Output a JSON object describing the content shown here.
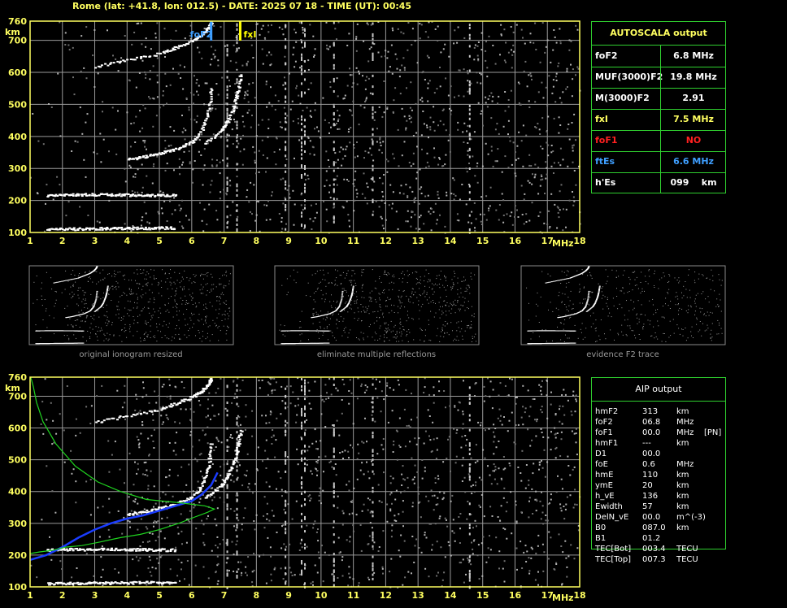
{
  "header": {
    "title": "Rome (lat: +41.8, lon: 012.5) - DATE: 2025 07 18 - TIME (UT): 00:45"
  },
  "colors": {
    "axis": "#ffff60",
    "grid": "#9a9a9a",
    "trace": "#ffffff",
    "box": "#2fcf2f",
    "foF2_marker": "#3f9fff",
    "fxI_marker": "#ffff00",
    "profile_blue": "#1a3cff",
    "profile_green": "#1fd41f",
    "nofoF1": "#ff2020"
  },
  "chart_data": [
    {
      "type": "scatter",
      "name": "main-ionogram",
      "title": "",
      "xlabel": "MHz",
      "ylabel": "km",
      "xlim": [
        1,
        18
      ],
      "ylim": [
        100,
        760
      ],
      "xticks": [
        1,
        2,
        3,
        4,
        5,
        6,
        7,
        8,
        9,
        10,
        11,
        12,
        13,
        14,
        15,
        16,
        17,
        18
      ],
      "yticks": [
        100,
        200,
        300,
        400,
        500,
        600,
        700,
        760
      ],
      "grid": true,
      "markers": [
        {
          "label": "foF2",
          "x": 6.6
        },
        {
          "label": "fxI",
          "x": 7.5
        }
      ],
      "traces": [
        {
          "name": "E-layer echo",
          "x": [
            1.5,
            2,
            2.5,
            3,
            3.5,
            4,
            4.5,
            5,
            5.5
          ],
          "y": [
            112,
            113,
            113,
            114,
            114,
            115,
            115,
            116,
            116
          ]
        },
        {
          "name": "second-hop E echo",
          "x": [
            1.5,
            2,
            2.5,
            3,
            3.5,
            4,
            4.5,
            5,
            5.5
          ],
          "y": [
            218,
            219,
            220,
            220,
            220,
            219,
            219,
            218,
            218
          ]
        },
        {
          "name": "F2 ordinary trace",
          "x": [
            4,
            4.5,
            5,
            5.5,
            6,
            6.3,
            6.5,
            6.6
          ],
          "y": [
            330,
            338,
            350,
            362,
            385,
            420,
            480,
            560
          ]
        },
        {
          "name": "F2 extraordinary trace",
          "x": [
            6.4,
            6.9,
            7.1,
            7.3,
            7.4,
            7.5
          ],
          "y": [
            380,
            420,
            450,
            500,
            540,
            600
          ]
        },
        {
          "name": "multiple F2 reflection",
          "x": [
            3,
            4,
            5,
            5.5,
            6,
            6.3,
            6.5,
            6.6
          ],
          "y": [
            620,
            640,
            660,
            680,
            700,
            720,
            740,
            760
          ]
        }
      ]
    },
    {
      "type": "line",
      "name": "aip-profile",
      "xlabel": "MHz",
      "ylabel": "km",
      "xlim": [
        1,
        18
      ],
      "ylim": [
        100,
        760
      ],
      "xticks": [
        1,
        2,
        3,
        4,
        5,
        6,
        7,
        8,
        9,
        10,
        11,
        12,
        13,
        14,
        15,
        16,
        17,
        18
      ],
      "yticks": [
        100,
        200,
        300,
        400,
        500,
        600,
        700,
        760
      ],
      "grid": true,
      "series": [
        {
          "color": "blue",
          "x": [
            1,
            1.5,
            2,
            2.5,
            3,
            3.5,
            4,
            4.5,
            5,
            5.5,
            6,
            6.3,
            6.6,
            6.8
          ],
          "y": [
            185,
            200,
            225,
            255,
            280,
            300,
            315,
            325,
            340,
            355,
            370,
            390,
            420,
            460
          ]
        },
        {
          "color": "green",
          "x": [
            1,
            1.3,
            1.7,
            2.1,
            2.6,
            3.1,
            3.8,
            4.4,
            5,
            5.6,
            6.1,
            6.5,
            6.7,
            6.4,
            5.6,
            4.6,
            3.8,
            3.1,
            2.4,
            1.8,
            1.4,
            1.2,
            1.1,
            1.02
          ],
          "y": [
            205,
            210,
            215,
            225,
            230,
            240,
            255,
            265,
            280,
            300,
            320,
            335,
            345,
            355,
            365,
            375,
            400,
            430,
            480,
            550,
            620,
            680,
            730,
            760
          ]
        }
      ]
    }
  ],
  "autoscala": {
    "title": "AUTOSCALA output",
    "rows": [
      {
        "label": "foF2",
        "value": "6.8 MHz",
        "color": "#ffffff"
      },
      {
        "label": "MUF(3000)F2",
        "value": "19.8 MHz",
        "color": "#ffffff"
      },
      {
        "label": "M(3000)F2",
        "value": "2.91",
        "color": "#ffffff"
      },
      {
        "label": "fxI",
        "value": "7.5 MHz",
        "color": "#ffff60"
      },
      {
        "label": "foF1",
        "value": "NO",
        "color": "#ff2020"
      },
      {
        "label": "ftEs",
        "value": "6.6 MHz",
        "color": "#3f9fff"
      },
      {
        "label": "h'Es",
        "value": "099    km",
        "color": "#ffffff"
      }
    ]
  },
  "aip": {
    "title": "AIP output",
    "rows": [
      {
        "name": "hmF2",
        "value": "313",
        "unit": "km",
        "extra": ""
      },
      {
        "name": "foF2",
        "value": "06.8",
        "unit": "MHz",
        "extra": ""
      },
      {
        "name": "foF1",
        "value": "00.0",
        "unit": "MHz",
        "extra": "[PN]"
      },
      {
        "name": "hmF1",
        "value": "---",
        "unit": "km",
        "extra": ""
      },
      {
        "name": "D1",
        "value": "00.0",
        "unit": "",
        "extra": ""
      },
      {
        "name": "foE",
        "value": "0.6",
        "unit": "MHz",
        "extra": ""
      },
      {
        "name": "hmE",
        "value": "110",
        "unit": "km",
        "extra": ""
      },
      {
        "name": "ymE",
        "value": "20",
        "unit": "km",
        "extra": ""
      },
      {
        "name": "h_vE",
        "value": "136",
        "unit": "km",
        "extra": ""
      },
      {
        "name": "Ewidth",
        "value": "57",
        "unit": "km",
        "extra": ""
      },
      {
        "name": "DelN_vE",
        "value": "00.0",
        "unit": "m^(-3)",
        "extra": ""
      },
      {
        "name": "B0",
        "value": "087.0",
        "unit": "km",
        "extra": ""
      },
      {
        "name": "B1",
        "value": "01.2",
        "unit": "",
        "extra": ""
      },
      {
        "name": "TEC[Bot]",
        "value": "003.4",
        "unit": "TECU",
        "extra": ""
      },
      {
        "name": "TEC[Top]",
        "value": "007.3",
        "unit": "TECU",
        "extra": ""
      }
    ]
  },
  "thumbnails": [
    {
      "caption": "original ionogram resized"
    },
    {
      "caption": "eliminate multiple reflections"
    },
    {
      "caption": "evidence F2 trace"
    }
  ]
}
